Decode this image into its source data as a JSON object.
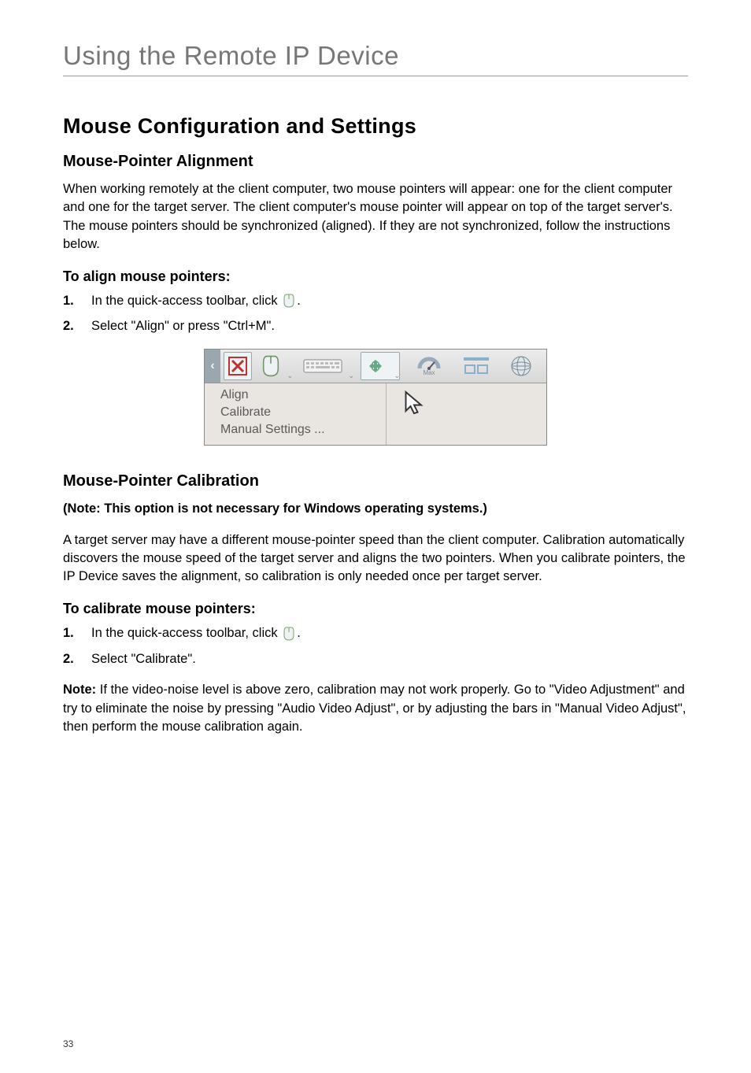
{
  "header": {
    "section_title": "Using the Remote IP Device"
  },
  "h2": "Mouse Configuration and Settings",
  "alignment": {
    "heading": "Mouse-Pointer Alignment",
    "para": "When working remotely at the client computer, two mouse pointers will appear: one for the client computer and one for the target server. The client computer's mouse pointer will appear on top of the target server's. The mouse pointers should be synchronized (aligned). If they are not synchronized, follow the instructions below.",
    "steps_heading": "To align mouse pointers:",
    "steps": [
      {
        "n": "1.",
        "text_pre": "In the quick-access toolbar, click ",
        "text_post": "."
      },
      {
        "n": "2.",
        "text": "Select \"Align\" or press \"Ctrl+M\"."
      }
    ]
  },
  "toolbar": {
    "icons": [
      "collapse-handle",
      "close-icon",
      "mouse-icon",
      "keyboard-icon",
      "video-adjust-icon",
      "performance-icon",
      "fullscreen-icon",
      "globe-icon"
    ],
    "perf_label": "Max",
    "menu_items": [
      "Align",
      "Calibrate",
      "Manual Settings ..."
    ]
  },
  "calibration": {
    "heading": "Mouse-Pointer Calibration",
    "note_bold": "(Note: This option is not necessary for Windows operating systems.)",
    "para": "A target server may have a different mouse-pointer speed than the client computer. Calibration automatically discovers the mouse speed of the target server and aligns the two pointers. When you calibrate pointers, the IP Device saves the alignment, so calibration is only needed once per target server.",
    "steps_heading": "To calibrate mouse pointers:",
    "steps": [
      {
        "n": "1.",
        "text_pre": "In the quick-access toolbar, click ",
        "text_post": "."
      },
      {
        "n": "2.",
        "text": "Select \"Calibrate\"."
      }
    ],
    "footnote_label": "Note:",
    "footnote_body": " If the video-noise level is above zero, calibration may not work properly. Go to \"Video Adjustment\" and try to eliminate the noise by pressing \"Audio Video Adjust\", or by adjusting the bars in \"Manual Video Adjust\", then perform the mouse calibration again."
  },
  "page_number": "33"
}
